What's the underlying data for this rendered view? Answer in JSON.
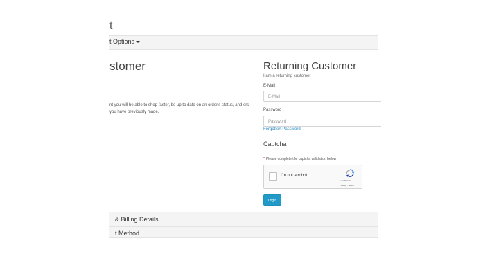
{
  "page": {
    "title_partial": "t"
  },
  "checkout_options": {
    "label": "t Options"
  },
  "left_column": {
    "heading": "stomer",
    "text": "nt you will be able to shop faster, be up to date on an order's status, and ers you have previously made."
  },
  "right_column": {
    "heading": "Returning Customer",
    "subheading": "I am a returning customer",
    "email_label": "E-Mail",
    "email_placeholder": "E-Mail",
    "password_label": "Password",
    "password_placeholder": "Password",
    "forgotten_password": "Forgotten Password"
  },
  "captcha": {
    "heading": "Captcha",
    "note": "Please complete the captcha validation below",
    "checkbox_label": "I'm not a robot",
    "brand": "reCAPTCHA",
    "privacy": "Privacy - Terms"
  },
  "login_button": "Login",
  "panels": [
    {
      "label": "& Billing Details"
    },
    {
      "label": "t Method"
    }
  ],
  "colors": {
    "accent": "#229ac8",
    "link": "#2a8ac4",
    "required": "#cc0000"
  }
}
